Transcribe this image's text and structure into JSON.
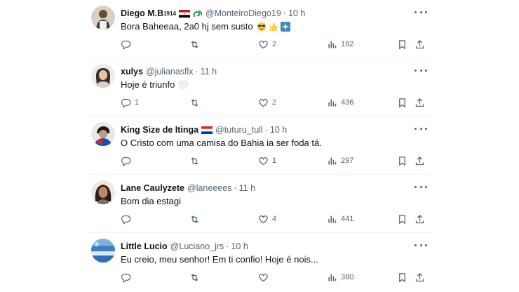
{
  "tweets": [
    {
      "name": "Diego M.B",
      "name_suffix": "1914",
      "handle": "@MonteiroDiego19",
      "time": "10 h",
      "text": "Bora Baheeaa, 2a0 hj sem susto",
      "emojis": [
        "sunglasses-emoji",
        "thumbs-up-emoji",
        "sparkle-emoji"
      ],
      "flag": "egypt-flag-icon",
      "badge": "green-swirl-icon",
      "replies": "",
      "retweets": "",
      "likes": "2",
      "views": "192"
    },
    {
      "name": "xulys",
      "handle": "@julianasflx",
      "time": "11 h",
      "text": "Hoje é triunfo",
      "emojis": [
        "white-heart-emoji"
      ],
      "replies": "1",
      "retweets": "",
      "likes": "2",
      "views": "436"
    },
    {
      "name": "King Size de Itinga",
      "handle": "@tuturu_tull",
      "time": "10 h",
      "text": "O Cristo com uma camisa do Bahia ia ser foda tá.",
      "flag": "paraguay-flag-icon",
      "replies": "",
      "retweets": "",
      "likes": "1",
      "views": "297"
    },
    {
      "name": "Lane Caulyzete",
      "handle": "@laneeees",
      "time": "11 h",
      "text": "Bom dia estagi",
      "replies": "",
      "retweets": "",
      "likes": "4",
      "views": "441"
    },
    {
      "name": "Little Lucio",
      "handle": "@Luciano_jrs",
      "time": "10 h",
      "text": "Eu creio, meu senhor! Em ti confio! Hoje é nois...",
      "replies": "",
      "retweets": "",
      "likes": "",
      "views": "380"
    }
  ],
  "separator": "·",
  "colors": {
    "text": "#0f1419",
    "muted": "#536471",
    "border": "#eff3f4"
  }
}
